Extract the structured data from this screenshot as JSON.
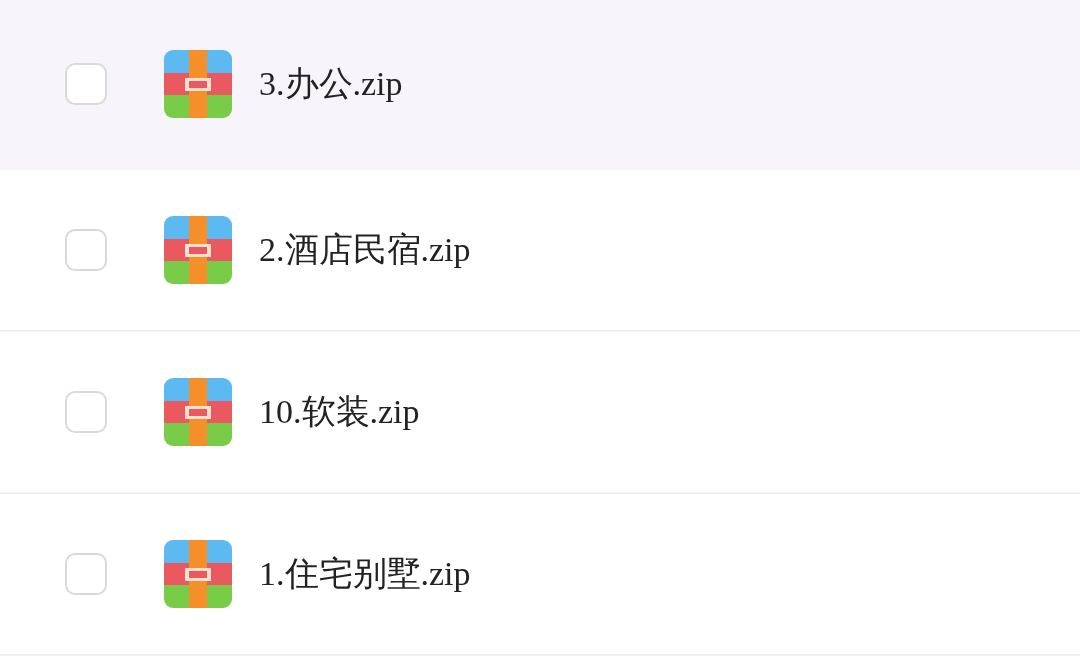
{
  "files": [
    {
      "name": "3.办公.zip",
      "checked": false,
      "selected": true
    },
    {
      "name": "2.酒店民宿.zip",
      "checked": false,
      "selected": false
    },
    {
      "name": "10.软装.zip",
      "checked": false,
      "selected": false
    },
    {
      "name": "1.住宅别墅.zip",
      "checked": false,
      "selected": false
    }
  ]
}
